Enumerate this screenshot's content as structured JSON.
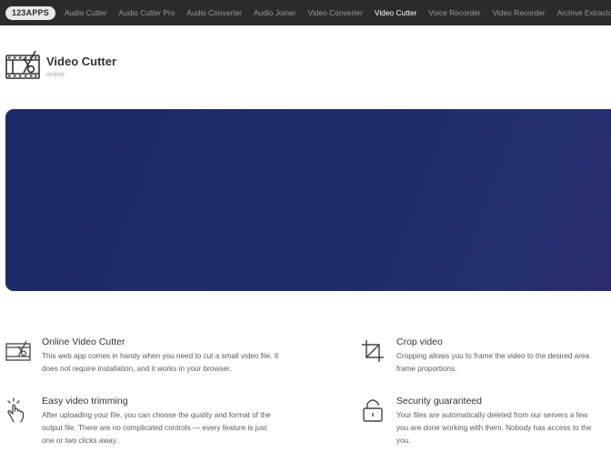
{
  "topbar": {
    "logo": "123APPS",
    "nav": [
      "Audio Cutter",
      "Audio Cutter Pro",
      "Audio Converter",
      "Audio Joiner",
      "Video Converter",
      "Video Cutter",
      "Voice Recorder",
      "Video Recorder",
      "Archive Extractor"
    ],
    "active": "Video Cutter"
  },
  "header": {
    "title": "Video Cutter",
    "subtitle": "online"
  },
  "colors": {
    "topbar": "#2b2b2b",
    "hero": "#1e2a6a"
  },
  "features": [
    {
      "icon": "film-scissors-icon",
      "title": "Online Video Cutter",
      "desc_lines": [
        "This web app comes in handy when you need to cut a small video file. It",
        "does not require installation, and it works in your browser."
      ]
    },
    {
      "icon": "crop-icon",
      "title": "Crop video",
      "desc_lines": [
        "Cropping allows you to frame the video to the desired area",
        "frame proportions."
      ]
    },
    {
      "icon": "hand-pointer-icon",
      "title": "Easy video trimming",
      "desc_lines": [
        "After uploading your file, you can choose the quality and format of the",
        "output file. There are no complicated controls — every feature is just",
        "one or two clicks away."
      ]
    },
    {
      "icon": "lock-icon",
      "title": "Security guaranteed",
      "desc_lines": [
        "Your files are automatically deleted from our servers a few",
        "you are done working with them. Nobody has access to the",
        "you."
      ]
    }
  ]
}
